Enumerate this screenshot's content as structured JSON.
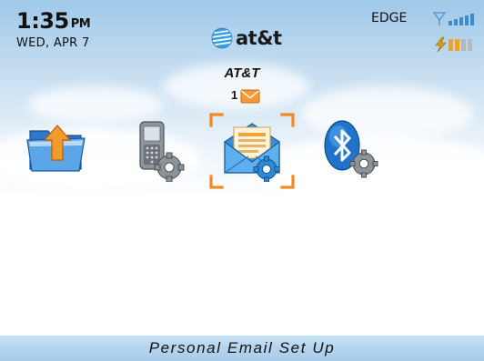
{
  "status": {
    "time": "1:35",
    "ampm": "PM",
    "date": "WED, APR 7",
    "network": "EDGE",
    "signal_icon": "signal-strength-icon",
    "battery_icon": "battery-charging-icon"
  },
  "carrier": {
    "logo_text": "at&t",
    "operator_name": "AT&T",
    "unread_count": "1"
  },
  "home_icons": [
    {
      "name": "file-transfer-icon"
    },
    {
      "name": "phone-options-icon"
    },
    {
      "name": "email-setup-icon",
      "selected": true
    },
    {
      "name": "bluetooth-options-icon"
    }
  ],
  "footer": {
    "selected_label": "Personal Email Set Up"
  },
  "colors": {
    "focus": "#f08a24",
    "label_bar": "#b6d6ef",
    "sky": "#9fc8e8"
  }
}
